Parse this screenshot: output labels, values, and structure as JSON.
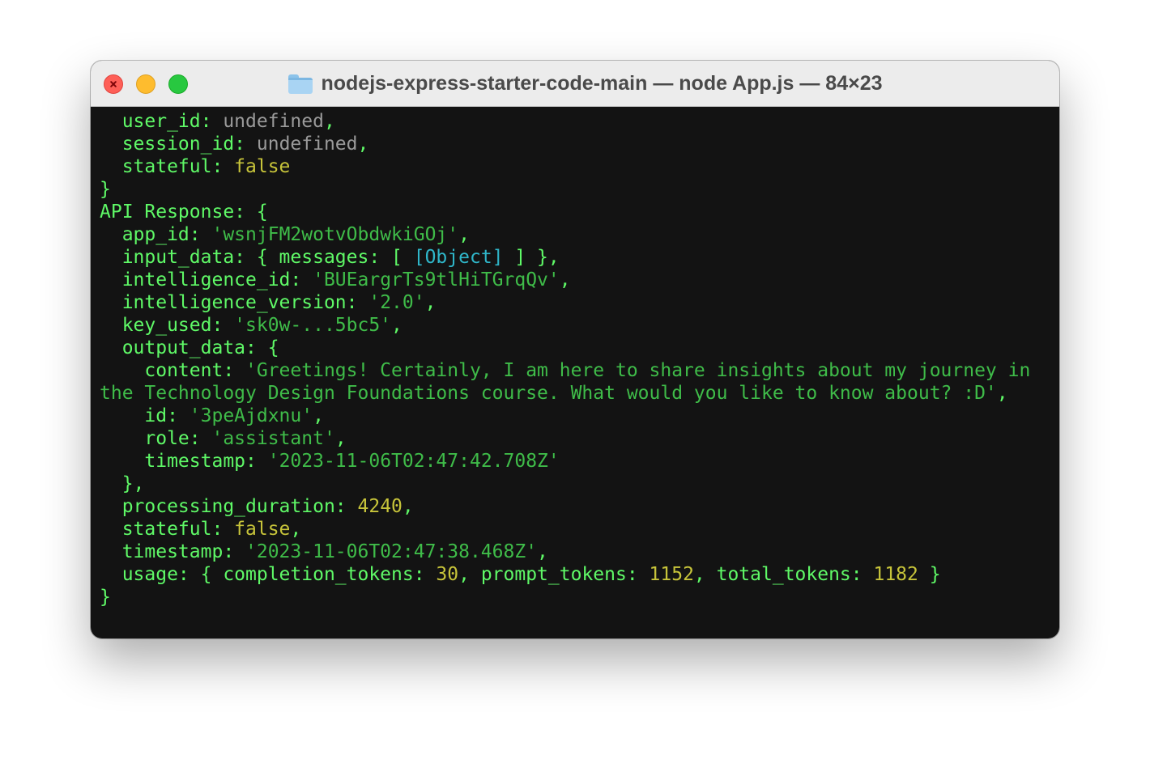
{
  "window": {
    "title": "nodejs-express-starter-code-main — node App.js — 84×23",
    "folder_icon": "folder-icon"
  },
  "colors": {
    "key": "#5ff967",
    "string": "#3fbc49",
    "number": "#c7c43a",
    "undefined": "#9a9a9a",
    "object_tag": "#2fb6c9",
    "background": "#131313"
  },
  "terminal": {
    "lines": [
      [
        {
          "t": "  user_id: ",
          "c": "k"
        },
        {
          "t": "undefined",
          "c": "u"
        },
        {
          "t": ",",
          "c": "k"
        }
      ],
      [
        {
          "t": "  session_id: ",
          "c": "k"
        },
        {
          "t": "undefined",
          "c": "u"
        },
        {
          "t": ",",
          "c": "k"
        }
      ],
      [
        {
          "t": "  stateful: ",
          "c": "k"
        },
        {
          "t": "false",
          "c": "n"
        }
      ],
      [
        {
          "t": "}",
          "c": "k"
        }
      ],
      [
        {
          "t": "API Response: {",
          "c": "k"
        }
      ],
      [
        {
          "t": "  app_id: ",
          "c": "k"
        },
        {
          "t": "'wsnjFM2wotvObdwkiGOj'",
          "c": "s"
        },
        {
          "t": ",",
          "c": "k"
        }
      ],
      [
        {
          "t": "  input_data: { messages: [ ",
          "c": "k"
        },
        {
          "t": "[Object]",
          "c": "c"
        },
        {
          "t": " ] },",
          "c": "k"
        }
      ],
      [
        {
          "t": "  intelligence_id: ",
          "c": "k"
        },
        {
          "t": "'BUEargrTs9tlHiTGrqQv'",
          "c": "s"
        },
        {
          "t": ",",
          "c": "k"
        }
      ],
      [
        {
          "t": "  intelligence_version: ",
          "c": "k"
        },
        {
          "t": "'2.0'",
          "c": "s"
        },
        {
          "t": ",",
          "c": "k"
        }
      ],
      [
        {
          "t": "  key_used: ",
          "c": "k"
        },
        {
          "t": "'sk0w-...5bc5'",
          "c": "s"
        },
        {
          "t": ",",
          "c": "k"
        }
      ],
      [
        {
          "t": "  output_data: {",
          "c": "k"
        }
      ],
      [
        {
          "t": "    content: ",
          "c": "k"
        },
        {
          "t": "'Greetings! Certainly, I am here to share insights about my journey in",
          "c": "s"
        }
      ],
      [
        {
          "t": "the Technology Design Foundations course. What would you like to know about? :D'",
          "c": "s"
        },
        {
          "t": ",",
          "c": "k"
        }
      ],
      [
        {
          "t": "    id: ",
          "c": "k"
        },
        {
          "t": "'3peAjdxnu'",
          "c": "s"
        },
        {
          "t": ",",
          "c": "k"
        }
      ],
      [
        {
          "t": "    role: ",
          "c": "k"
        },
        {
          "t": "'assistant'",
          "c": "s"
        },
        {
          "t": ",",
          "c": "k"
        }
      ],
      [
        {
          "t": "    timestamp: ",
          "c": "k"
        },
        {
          "t": "'2023-11-06T02:47:42.708Z'",
          "c": "s"
        }
      ],
      [
        {
          "t": "  },",
          "c": "k"
        }
      ],
      [
        {
          "t": "  processing_duration: ",
          "c": "k"
        },
        {
          "t": "4240",
          "c": "n"
        },
        {
          "t": ",",
          "c": "k"
        }
      ],
      [
        {
          "t": "  stateful: ",
          "c": "k"
        },
        {
          "t": "false",
          "c": "n"
        },
        {
          "t": ",",
          "c": "k"
        }
      ],
      [
        {
          "t": "  timestamp: ",
          "c": "k"
        },
        {
          "t": "'2023-11-06T02:47:38.468Z'",
          "c": "s"
        },
        {
          "t": ",",
          "c": "k"
        }
      ],
      [
        {
          "t": "  usage: { completion_tokens: ",
          "c": "k"
        },
        {
          "t": "30",
          "c": "n"
        },
        {
          "t": ", prompt_tokens: ",
          "c": "k"
        },
        {
          "t": "1152",
          "c": "n"
        },
        {
          "t": ", total_tokens: ",
          "c": "k"
        },
        {
          "t": "1182",
          "c": "n"
        },
        {
          "t": " }",
          "c": "k"
        }
      ],
      [
        {
          "t": "}",
          "c": "k"
        }
      ]
    ]
  }
}
